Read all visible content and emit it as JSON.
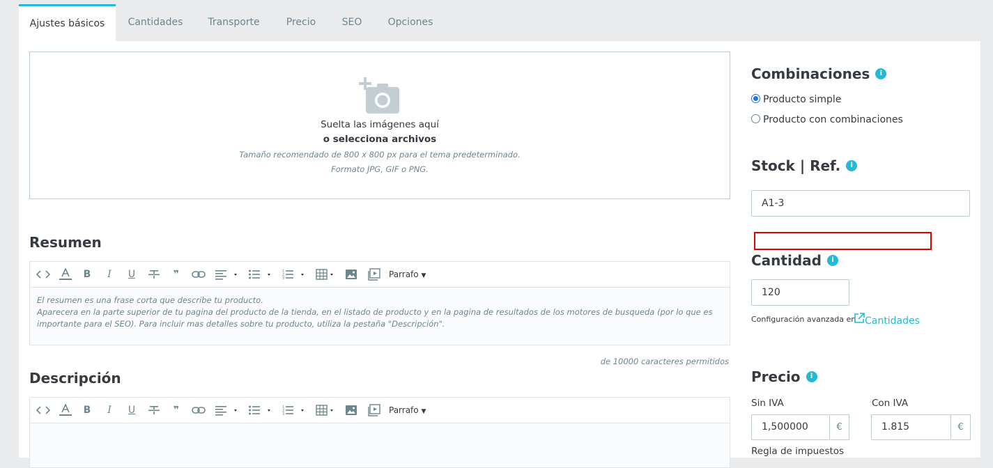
{
  "tabs": [
    "Ajustes básicos",
    "Cantidades",
    "Transporte",
    "Precio",
    "SEO",
    "Opciones"
  ],
  "dropzone": {
    "line1": "Suelta las imágenes aquí",
    "line2": "o selecciona archivos",
    "line3": "Tamaño recomendado de 800 x 800 px para el tema predeterminado.",
    "line4": "Formato JPG, GIF o PNG."
  },
  "summary": {
    "title": "Resumen",
    "placeholder_line1": "El resumen es una frase corta que describe tu producto.",
    "placeholder_line2": "Aparecera en la parte superior de tu pagina del producto de la tienda, en el listado de producto y en la pagina de resultados de los motores de busqueda (por lo que es importante para el SEO). Para incluir mas detalles sobre tu producto, utiliza la pestaña \"Descripción\".",
    "counter": "de 10000 caracteres permitidos"
  },
  "description": {
    "title": "Descripción"
  },
  "toolbar": {
    "format_label": "Parrafo"
  },
  "combinations": {
    "title": "Combinaciones",
    "options": [
      "Producto simple",
      "Producto con combinaciones"
    ],
    "selected": 0
  },
  "stock": {
    "title": "Stock | Ref.",
    "reference": "A1-3"
  },
  "quantity": {
    "title": "Cantidad",
    "value": "120",
    "advanced_text": "Configuración avanzada en",
    "advanced_link": "Cantidades"
  },
  "price": {
    "title": "Precio",
    "excl_label": "Sin IVA",
    "excl_value": "1,500000",
    "incl_label": "Con IVA",
    "incl_value": "1.815",
    "currency": "€",
    "tax_rule_label": "Regla de impuestos"
  },
  "colors": {
    "accent": "#25b9d7",
    "highlight": "#e00000"
  }
}
